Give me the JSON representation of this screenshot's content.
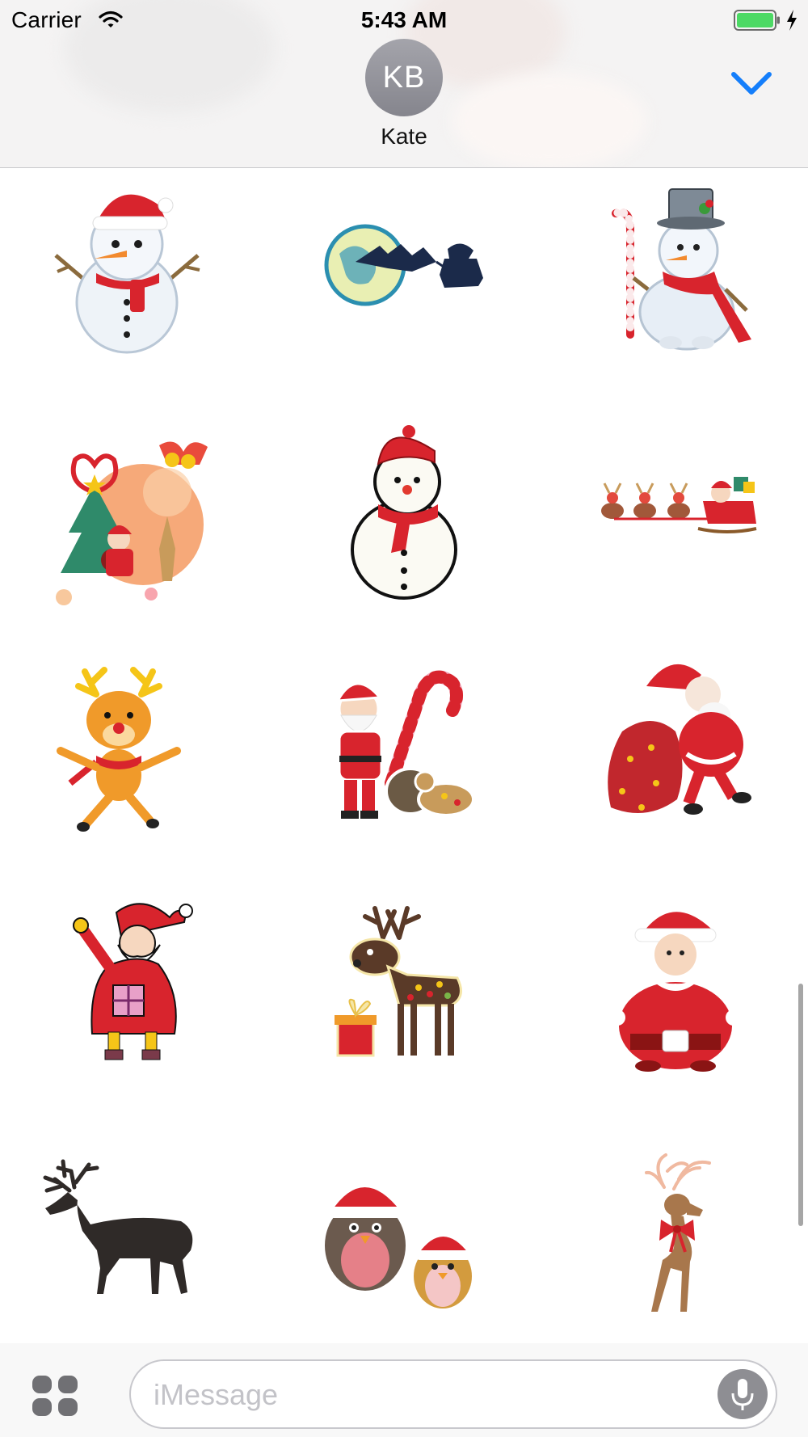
{
  "status_bar": {
    "carrier": "Carrier",
    "time": "5:43 AM",
    "icons": [
      "wifi-icon",
      "battery-icon",
      "charging-bolt-icon"
    ],
    "battery_color": "#4cd964"
  },
  "header": {
    "avatar_initials": "KB",
    "contact_name": "Kate",
    "collapse_icon": "chevron-down-icon",
    "accent_color": "#147efb"
  },
  "stickers": [
    {
      "name": "snowman-red-hat"
    },
    {
      "name": "sleigh-moon-silhouette"
    },
    {
      "name": "snowman-top-hat-candy-cane"
    },
    {
      "name": "santa-christmas-tree-reindeer"
    },
    {
      "name": "snowman-red-scarf-sketch"
    },
    {
      "name": "reindeer-pulling-sleigh"
    },
    {
      "name": "dancing-reindeer"
    },
    {
      "name": "santa-candy-cane-sack"
    },
    {
      "name": "santa-with-gift-sack"
    },
    {
      "name": "santa-waving-with-present"
    },
    {
      "name": "brown-reindeer-with-gift"
    },
    {
      "name": "round-santa"
    },
    {
      "name": "reindeer-silhouette"
    },
    {
      "name": "birds-in-santa-hats"
    },
    {
      "name": "reindeer-with-bow"
    }
  ],
  "input": {
    "placeholder": "iMessage",
    "apps_icon": "app-drawer-icon",
    "mic_icon": "microphone-icon"
  }
}
